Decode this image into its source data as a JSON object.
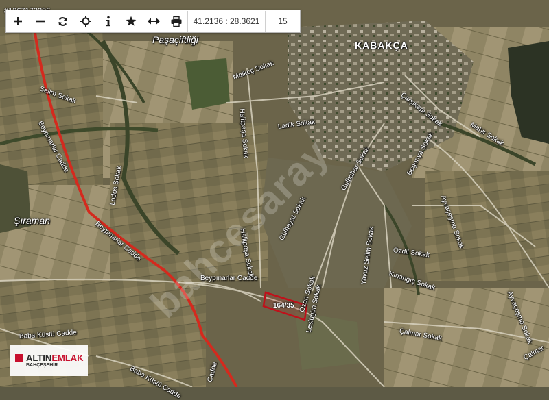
{
  "listing_id": "#1267173206",
  "toolbar": {
    "buttons": [
      {
        "name": "zoom-in-button",
        "icon": "plus-icon"
      },
      {
        "name": "zoom-out-button",
        "icon": "minus-icon"
      },
      {
        "name": "refresh-button",
        "icon": "refresh-icon"
      },
      {
        "name": "locate-button",
        "icon": "crosshair-icon"
      },
      {
        "name": "info-button",
        "icon": "info-icon"
      },
      {
        "name": "favorite-button",
        "icon": "star-icon"
      },
      {
        "name": "measure-button",
        "icon": "arrows-horizontal-icon"
      },
      {
        "name": "print-button",
        "icon": "printer-icon"
      }
    ],
    "coordinates": "41.2136 : 28.3621",
    "zoom_level": "15"
  },
  "labels": {
    "village": "KABAKÇA",
    "pasaciftligi": "Paşaçiftliği",
    "siraman": "Şıraman",
    "streets": {
      "selim": "Selim Sokak",
      "beypinarlar_north": "Beypınarlar Cadde",
      "beypinarlar_mid": "Beypınarlar Cadde",
      "beypinarlar_south": "Beypınarlar Cadde",
      "malkoc": "Malkoç Sokak",
      "halitpasa_north": "Halitpaşa Sokak",
      "halitpasa_south": "Halitpaşa Sokak",
      "ladik": "Ladik Sokak",
      "carsikapi": "Çarşıkapı Sokak",
      "mahir": "Mahir Sokak",
      "lodos": "Lodos Sokak",
      "gulbahar": "Gülbahar Sokak",
      "begonya": "Begonya Sokak",
      "gulhayat": "Gülhayat Sokak",
      "ayvacesme": "Ayvaçeşme Sokak",
      "ayvacesme_east": "Ayvaçeşme Sokak",
      "ozdil": "Özdil Sokak",
      "yavuzselim": "Yavuz Selim Sokak",
      "kirlangic": "Kırlangıç Sokak",
      "ozan": "Ozan Sokak",
      "calmar": "Çalmar Sokak",
      "calmar_east": "Çalmar",
      "lesligun": "Leslügün Sokak",
      "babakustu_1": "Baba Küstü Cadde",
      "babakustu_2": "Baba Küstü Cadde",
      "cadde_bottom": "Cadde"
    }
  },
  "parcel": {
    "label": "164/35"
  },
  "watermark": "bahcesaray",
  "logo": {
    "brand_part1": "ALTIN",
    "brand_part2": "EMLAK",
    "subtitle": "BAHÇEŞEHİR"
  },
  "colors": {
    "main_road": "#d42a1e",
    "parcel_outline": "#c0101a",
    "brand": "#c8102e"
  }
}
